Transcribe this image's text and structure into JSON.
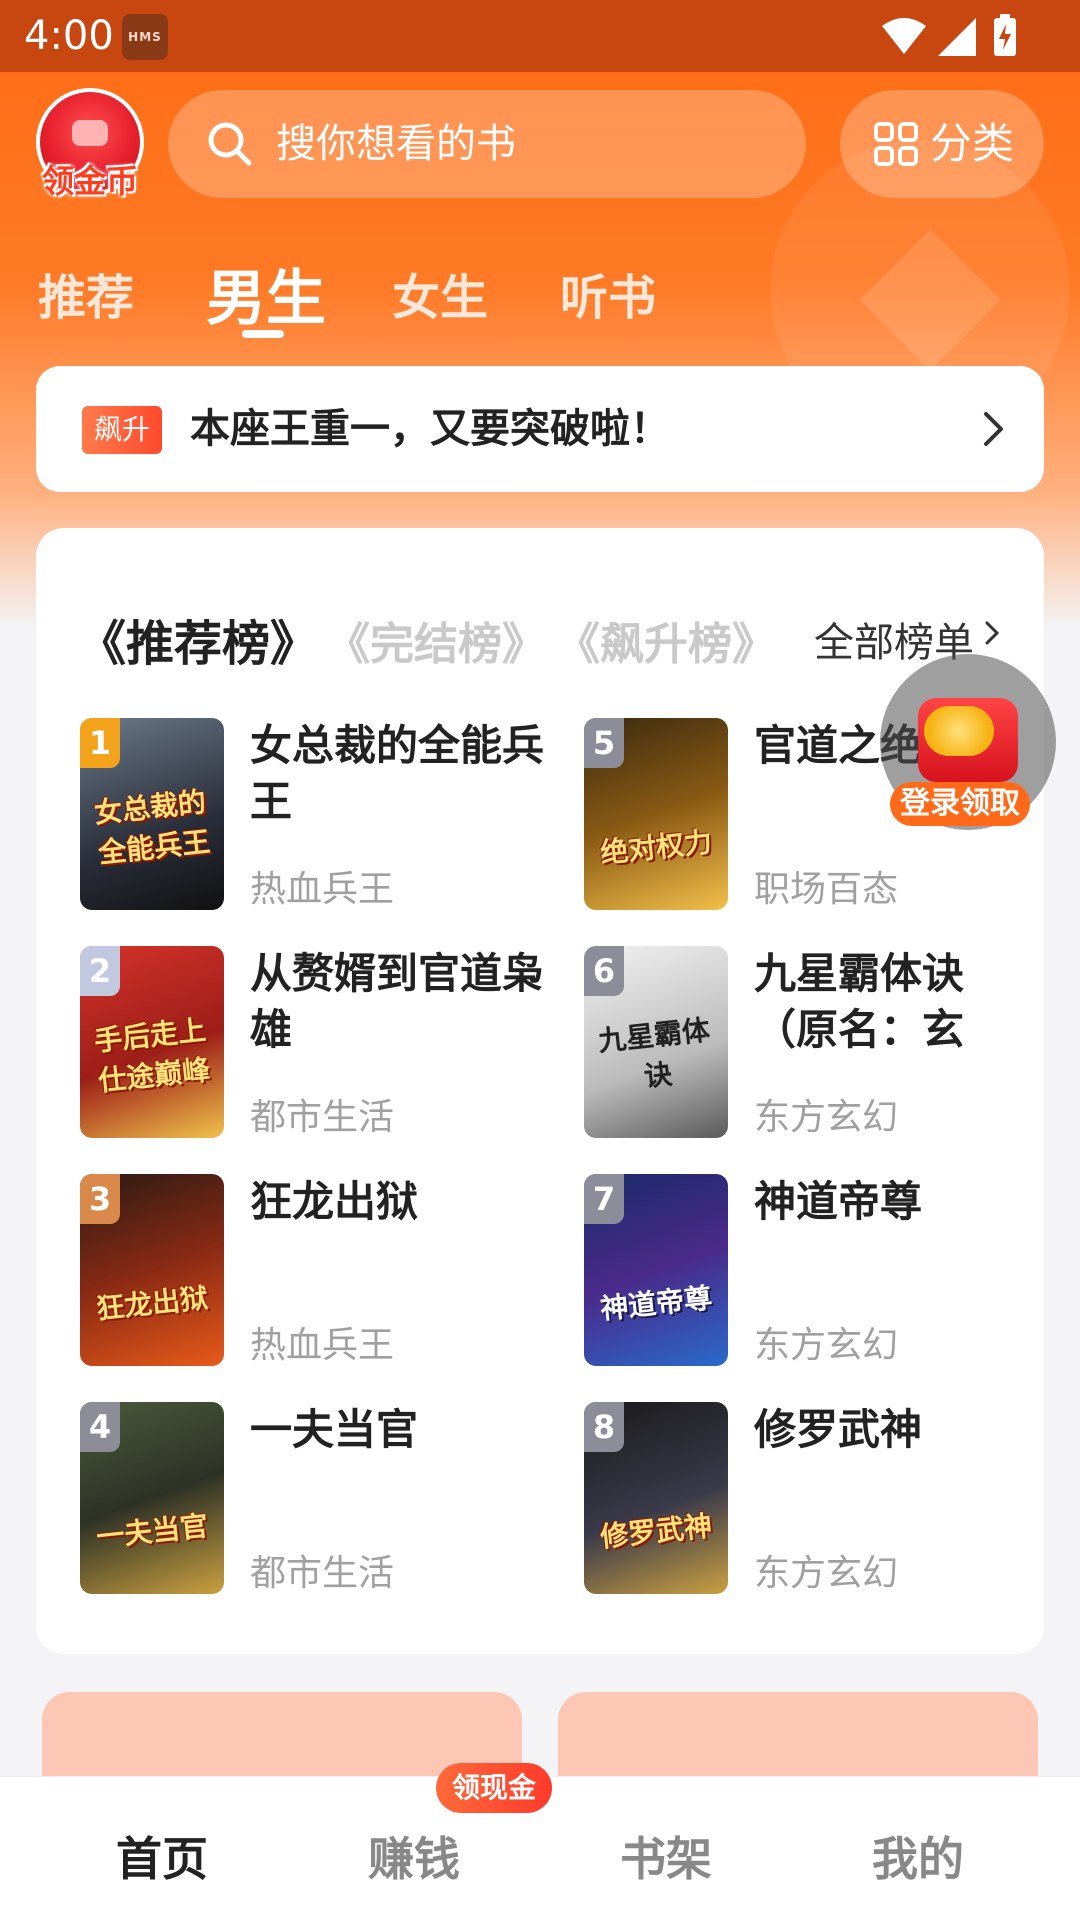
{
  "status_bar": {
    "time": "4:00",
    "hms_badge": "HMS"
  },
  "header": {
    "coin_avatar_label": "领金币",
    "search_placeholder": "搜你想看的书",
    "category_label": "分类"
  },
  "tabs": [
    {
      "label": "推荐",
      "active": false
    },
    {
      "label": "男生",
      "active": true
    },
    {
      "label": "女生",
      "active": false
    },
    {
      "label": "听书",
      "active": false
    }
  ],
  "notice": {
    "badge": "飙升",
    "text": "本座王重一，又要突破啦！"
  },
  "ranking": {
    "tabs": [
      {
        "label": "推荐榜",
        "active": true
      },
      {
        "label": "完结榜",
        "active": false
      },
      {
        "label": "飙升榜",
        "active": false
      }
    ],
    "all_lists": "全部榜单",
    "books": [
      {
        "rank": "1",
        "title": "女总裁的全能兵王",
        "genre": "热血兵王",
        "cover_text": "女总裁的全能兵王"
      },
      {
        "rank": "2",
        "title": "从赘婿到官道枭雄",
        "genre": "都市生活",
        "cover_text": "手后走上仕途巅峰"
      },
      {
        "rank": "3",
        "title": "狂龙出狱",
        "genre": "热血兵王",
        "cover_text": "狂龙出狱"
      },
      {
        "rank": "4",
        "title": "一夫当官",
        "genre": "都市生活",
        "cover_text": "一夫当官"
      },
      {
        "rank": "5",
        "title": "官道之绝对权力",
        "genre": "职场百态",
        "cover_text": "绝对权力"
      },
      {
        "rank": "6",
        "title": "九星霸体诀（原名：玄天霸体诀）",
        "genre": "东方玄幻",
        "cover_text": "九星霸体诀"
      },
      {
        "rank": "7",
        "title": "神道帝尊",
        "genre": "东方玄幻",
        "cover_text": "神道帝尊"
      },
      {
        "rank": "8",
        "title": "修罗武神",
        "genre": "东方玄幻",
        "cover_text": "修罗武神"
      }
    ]
  },
  "floating_reward": {
    "label": "登录领取"
  },
  "bottom_nav": {
    "items": [
      {
        "label": "首页",
        "active": true
      },
      {
        "label": "赚钱",
        "active": false
      },
      {
        "label": "书架",
        "active": false
      },
      {
        "label": "我的",
        "active": false
      }
    ],
    "earn_badge": "领现金"
  },
  "colors": {
    "accent": "#ff6a12",
    "status_bar": "#c84711",
    "rank_gold": "#f3a31b",
    "rank_grey": "#8d8d99"
  }
}
